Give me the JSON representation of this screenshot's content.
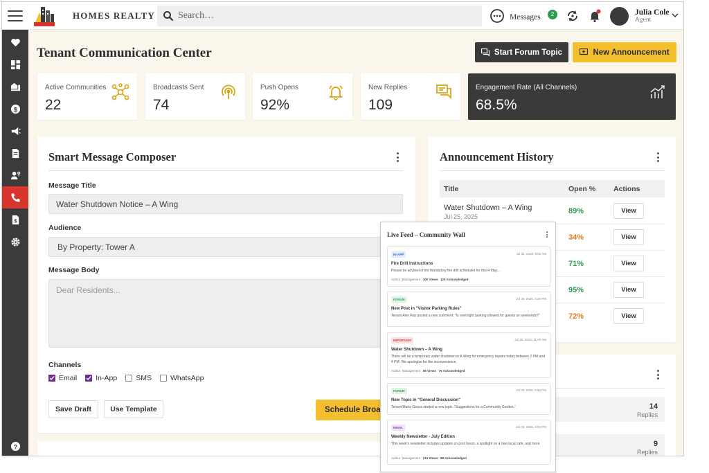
{
  "header": {
    "brand": "HOMES REALTY",
    "search_placeholder": "Search…",
    "messages_label": "Messages",
    "messages_count": "2",
    "user_name": "Julia Cole",
    "user_role": "Agent"
  },
  "page": {
    "title": "Tenant Communication Center",
    "start_forum_label": "Start Forum Topic",
    "new_announcement_label": "New Announcement"
  },
  "stats": [
    {
      "label": "Active Communities",
      "value": "22",
      "icon": "network-icon"
    },
    {
      "label": "Broadcasts Sent",
      "value": "74",
      "icon": "broadcast-icon"
    },
    {
      "label": "Push Opens",
      "value": "92%",
      "icon": "bell-icon"
    },
    {
      "label": "New Replies",
      "value": "109",
      "icon": "chat-icon"
    },
    {
      "label": "Engagement Rate (All Channels)",
      "value": "68.5%",
      "icon": "trend-chart-icon"
    }
  ],
  "composer": {
    "title": "Smart Message Composer",
    "message_title_label": "Message Title",
    "message_title_value": "Water Shutdown Notice – A Wing",
    "audience_label": "Audience",
    "audience_value": "By Property: Tower A",
    "body_label": "Message Body",
    "body_placeholder": "Dear Residents...",
    "channels_label": "Channels",
    "channels": [
      {
        "label": "Email",
        "checked": true
      },
      {
        "label": "In-App",
        "checked": true
      },
      {
        "label": "SMS",
        "checked": false
      },
      {
        "label": "WhatsApp",
        "checked": false
      }
    ],
    "save_draft_label": "Save Draft",
    "use_template_label": "Use Template",
    "schedule_label": "Schedule Broadcast"
  },
  "history": {
    "title": "Announcement History",
    "columns": [
      "Title",
      "Open %",
      "Actions"
    ],
    "rows": [
      {
        "title": "Water Shutdown – A Wing",
        "date": "Jul 25, 2025",
        "open": "89%",
        "color": "#2e9b4e",
        "action": "View"
      },
      {
        "title": "",
        "date": "",
        "open": "34%",
        "color": "#e07b22",
        "action": "View"
      },
      {
        "title": "",
        "date": "",
        "open": "71%",
        "color": "#2e9b4e",
        "action": "View"
      },
      {
        "title": "",
        "date": "",
        "open": "95%",
        "color": "#2e9b4e",
        "action": "View"
      },
      {
        "title": "",
        "date": "",
        "open": "72%",
        "color": "#e07b22",
        "action": "View"
      }
    ]
  },
  "replies": {
    "rows": [
      {
        "count": "14",
        "label": "Replies"
      },
      {
        "count": "9",
        "label": "Replies"
      }
    ]
  },
  "feed": {
    "title": "Live Feed – Community Wall",
    "posts": [
      {
        "tag": "IN-APP",
        "tag_color": "#3b6fd1",
        "tag_bg": "#e3ecfb",
        "date": "Jul 31, 2025, 9:52 AM",
        "title": "Fire Drill Instructions",
        "body": "Please be advised of the mandatory fire drill scheduled for this Friday...",
        "author": "Author: Management",
        "views": "100 Views",
        "ack": "120 Acknowledged"
      },
      {
        "tag": "FORUM",
        "tag_color": "#2e9b4e",
        "tag_bg": "#e2f4e7",
        "date": "Jul 30, 2025, 4:30 PM",
        "title": "New Post in \"Visitor Parking Rules\"",
        "body": "Tenant Alex Ray posted a new comment: \"Is overnight parking allowed for guests on weekends?\"",
        "author": "",
        "views": "",
        "ack": ""
      },
      {
        "tag": "IMPORTANT",
        "tag_color": "#d8342e",
        "tag_bg": "#fbe4e3",
        "date": "Jul 30, 2025, 11:00 AM",
        "title": "Water Shutdown – A Wing",
        "body": "There will be a temporary water shutdown in A Wing for emergency repairs today between 2 PM and 4 PM. We apologize for the inconvenience.",
        "author": "Author: Management",
        "views": "98 Views",
        "ack": "75 Acknowledged"
      },
      {
        "tag": "FORUM",
        "tag_color": "#2e9b4e",
        "tag_bg": "#e2f4e7",
        "date": "Jul 29, 2025, 8:52 PM",
        "title": "New Topic in \"General Discussion\"",
        "body": "Tenant Maria Garcia started a new topic: \"Suggestions for a Community Garden.\"",
        "author": "",
        "views": "",
        "ack": ""
      },
      {
        "tag": "EMAIL",
        "tag_color": "#7a3fb5",
        "tag_bg": "#efe4f8",
        "date": "Jul 29, 2025, 3:06 PM",
        "title": "Weekly Newsletter - July Edition",
        "body": "This week's newsletter includes updates on pool hours, a spotlight on a new local cafe, and more.",
        "author": "Author: Management",
        "views": "213 Views",
        "ack": "88 Acknowledged"
      }
    ]
  }
}
